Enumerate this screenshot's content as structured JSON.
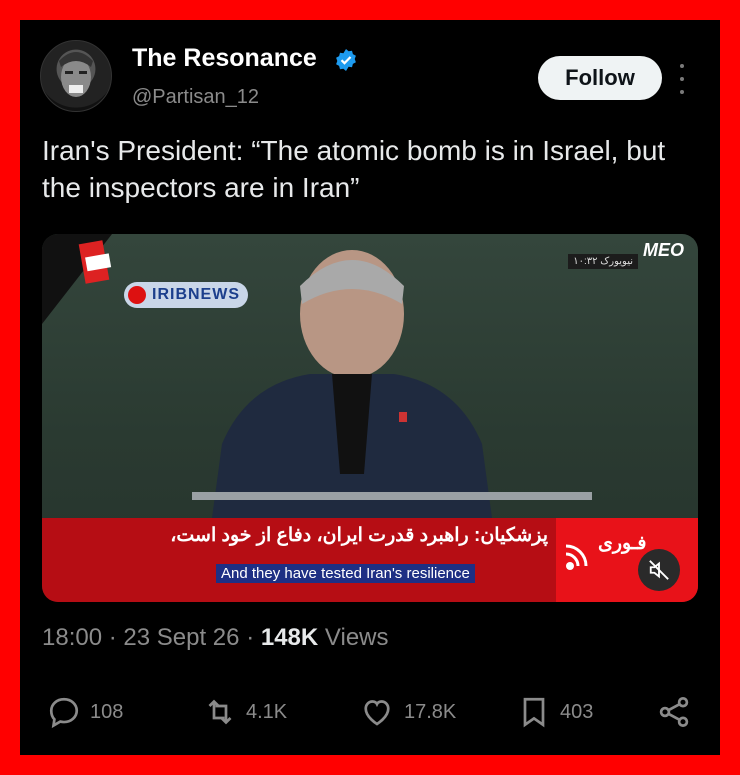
{
  "author": {
    "name": "The Resonance",
    "handle": "@Partisan_12",
    "follow_label": "Follow",
    "verified_color": "#1d9bf0"
  },
  "tweet": {
    "text": "Iran's President: “The atomic bomb is in Israel, but the inspectors are in Iran”"
  },
  "media": {
    "channel_label": "IRIBNEWS",
    "logo_text": "MEO",
    "clock_text": "نیویورک ۱۰:۳۲",
    "headline": "پزشکیان: راهبرد قدرت ایران، دفاع از خود است،",
    "breaking_label": "فـوری",
    "subtitle": "And they have tested Iran's resilience",
    "mute_icon": "speaker-muted-icon"
  },
  "meta": {
    "time": "18:00",
    "separator1": "·",
    "date": "23 Sept 26",
    "separator2": "·",
    "views_count": "148K",
    "views_label": "Views"
  },
  "actions": {
    "replies": "108",
    "reposts": "4.1K",
    "likes": "17.8K",
    "bookmarks": "403"
  },
  "colors": {
    "border": "#ff0000",
    "background": "#000000",
    "lower_third": "#b60d14"
  }
}
